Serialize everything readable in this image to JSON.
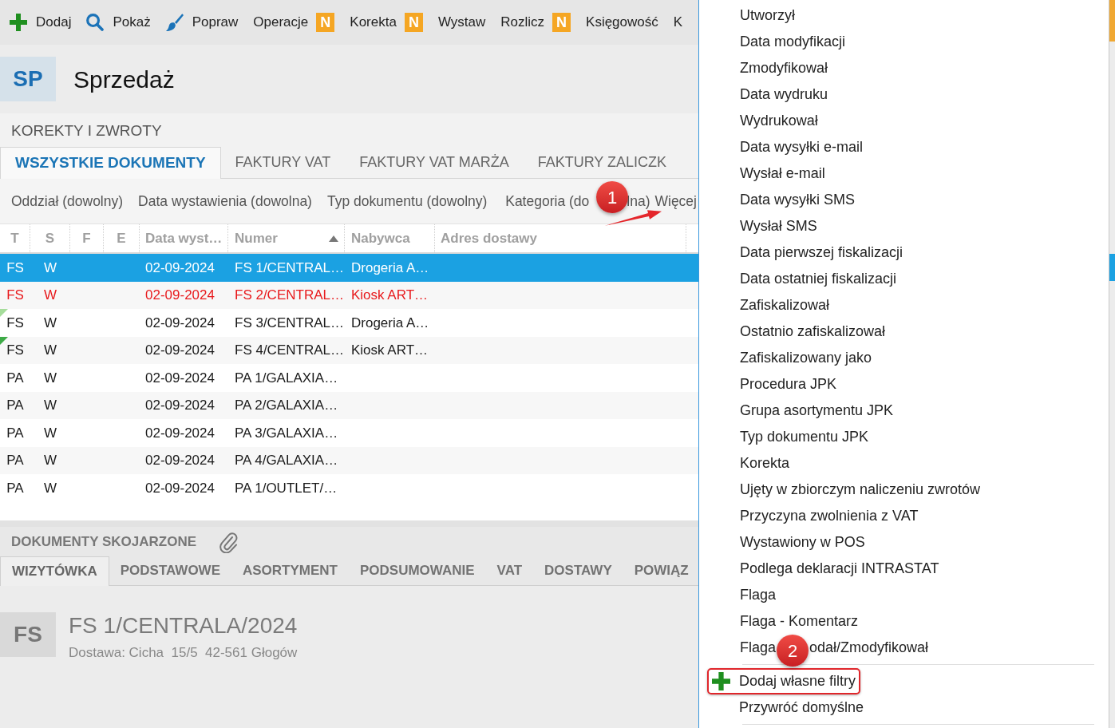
{
  "toolbar": [
    {
      "kind": "add",
      "label": "Dodaj"
    },
    {
      "kind": "search",
      "label": "Pokaż"
    },
    {
      "kind": "edit",
      "label": "Popraw"
    },
    {
      "kind": "plain",
      "label": "Operacje",
      "badge": "N"
    },
    {
      "kind": "plain",
      "label": "Korekta",
      "badge": "N"
    },
    {
      "kind": "plain",
      "label": "Wystaw"
    },
    {
      "kind": "plain",
      "label": "Rozlicz",
      "badge": "N"
    },
    {
      "kind": "plain",
      "label": "Księgowość"
    },
    {
      "kind": "plain",
      "label": "K"
    }
  ],
  "module": {
    "badge": "SP",
    "title": "Sprzedaż"
  },
  "section_title": "KOREKTY I ZWROTY",
  "tabs": [
    {
      "label": "WSZYSTKIE DOKUMENTY",
      "selected": true
    },
    {
      "label": "FAKTURY VAT",
      "selected": false
    },
    {
      "label": "FAKTURY VAT MARŻA",
      "selected": false
    },
    {
      "label": "FAKTURY ZALICZK",
      "selected": false
    }
  ],
  "filters": {
    "items": [
      {
        "label": "Oddział (dowolny)"
      },
      {
        "label": "Data wystawienia (dowolna)"
      },
      {
        "label": "Typ dokumentu (dowolny)"
      },
      {
        "label": "Kategoria (do",
        "label_rest": "lna)"
      }
    ],
    "more": "Więcej"
  },
  "table": {
    "columns": [
      {
        "label": "T",
        "sorted": false
      },
      {
        "label": "S",
        "sorted": false
      },
      {
        "label": "F",
        "sorted": false
      },
      {
        "label": "E",
        "sorted": false
      },
      {
        "label": "Data wyst…",
        "sorted": false
      },
      {
        "label": "Numer",
        "sorted": true
      },
      {
        "label": "Nabywca",
        "sorted": false
      },
      {
        "label": "Adres dostawy",
        "sorted": false
      }
    ],
    "rows": [
      {
        "t": "FS",
        "s": "W",
        "date": "02-09-2024",
        "number": "FS 1/CENTRAL…",
        "buyer": "Drogeria A…",
        "selected": true,
        "alert": false
      },
      {
        "t": "FS",
        "s": "W",
        "date": "02-09-2024",
        "number": "FS 2/CENTRAL…",
        "buyer": "Kiosk ART…",
        "selected": false,
        "alert": true
      },
      {
        "t": "FS",
        "s": "W",
        "date": "02-09-2024",
        "number": "FS 3/CENTRAL…",
        "buyer": "Drogeria A…",
        "selected": false,
        "alert": false,
        "flag": {
          "color": "#a6dd9b"
        }
      },
      {
        "t": "FS",
        "s": "W",
        "date": "02-09-2024",
        "number": "FS 4/CENTRAL…",
        "buyer": "Kiosk ART…",
        "selected": false,
        "alert": false,
        "flag": {
          "color": "#3daa46"
        }
      },
      {
        "t": "PA",
        "s": "W",
        "date": "02-09-2024",
        "number": "PA 1/GALAXIA…",
        "selected": false,
        "alert": false
      },
      {
        "t": "PA",
        "s": "W",
        "date": "02-09-2024",
        "number": "PA 2/GALAXIA…",
        "selected": false,
        "alert": false
      },
      {
        "t": "PA",
        "s": "W",
        "date": "02-09-2024",
        "number": "PA 3/GALAXIA…",
        "selected": false,
        "alert": false
      },
      {
        "t": "PA",
        "s": "W",
        "date": "02-09-2024",
        "number": "PA 4/GALAXIA…",
        "selected": false,
        "alert": false
      },
      {
        "t": "PA",
        "s": "W",
        "date": "02-09-2024",
        "number": "PA 1/OUTLET/…",
        "selected": false,
        "alert": false
      }
    ]
  },
  "related": {
    "title": "DOKUMENTY SKOJARZONE",
    "tabs": [
      {
        "label": "WIZYTÓWKA",
        "selected": true
      },
      {
        "label": "PODSTAWOWE",
        "selected": false
      },
      {
        "label": "ASORTYMENT",
        "selected": false
      },
      {
        "label": "PODSUMOWANIE",
        "selected": false
      },
      {
        "label": "VAT",
        "selected": false
      },
      {
        "label": "DOSTAWY",
        "selected": false
      },
      {
        "label": "POWIĄZ",
        "selected": false
      }
    ],
    "card": {
      "badge": "FS",
      "title": "FS 1/CENTRALA/2024",
      "subtitle": "Dostawa: Cicha  15/5  42-561 Głogów"
    }
  },
  "menu": {
    "items": [
      {
        "label": "Utworzył"
      },
      {
        "label": "Data modyfikacji"
      },
      {
        "label": "Zmodyfikował"
      },
      {
        "label": "Data wydruku"
      },
      {
        "label": "Wydrukował"
      },
      {
        "label": "Data wysyłki e-mail"
      },
      {
        "label": "Wysłał e-mail"
      },
      {
        "label": "Data wysyłki SMS"
      },
      {
        "label": "Wysłał SMS"
      },
      {
        "label": "Data pierwszej fiskalizacji"
      },
      {
        "label": "Data ostatniej fiskalizacji"
      },
      {
        "label": "Zafiskalizował"
      },
      {
        "label": "Ostatnio zafiskalizował"
      },
      {
        "label": "Zafiskalizowany jako"
      },
      {
        "label": "Procedura JPK"
      },
      {
        "label": "Grupa asortymentu JPK"
      },
      {
        "label": "Typ dokumentu JPK"
      },
      {
        "label": "Korekta"
      },
      {
        "label": "Ujęty w zbiorczym naliczeniu zwrotów"
      },
      {
        "label": "Przyczyna zwolnienia z VAT"
      },
      {
        "label": "Wystawiony w POS"
      },
      {
        "label": "Podlega deklaracji INTRASTAT"
      },
      {
        "label": "Flaga"
      },
      {
        "label": "Flaga - Komentarz"
      },
      {
        "label": "Flaga",
        "label_rest": "odał/Zmodyfikował"
      }
    ],
    "actions": [
      {
        "kind": "add",
        "label": "Dodaj własne filtry",
        "highlighted": true
      },
      {
        "kind": "plain",
        "label": "Przywróć domyślne",
        "highlighted": false
      }
    ]
  },
  "annotations": [
    {
      "label": "1",
      "arrow": true
    },
    {
      "label": "2",
      "arrow": false
    }
  ]
}
